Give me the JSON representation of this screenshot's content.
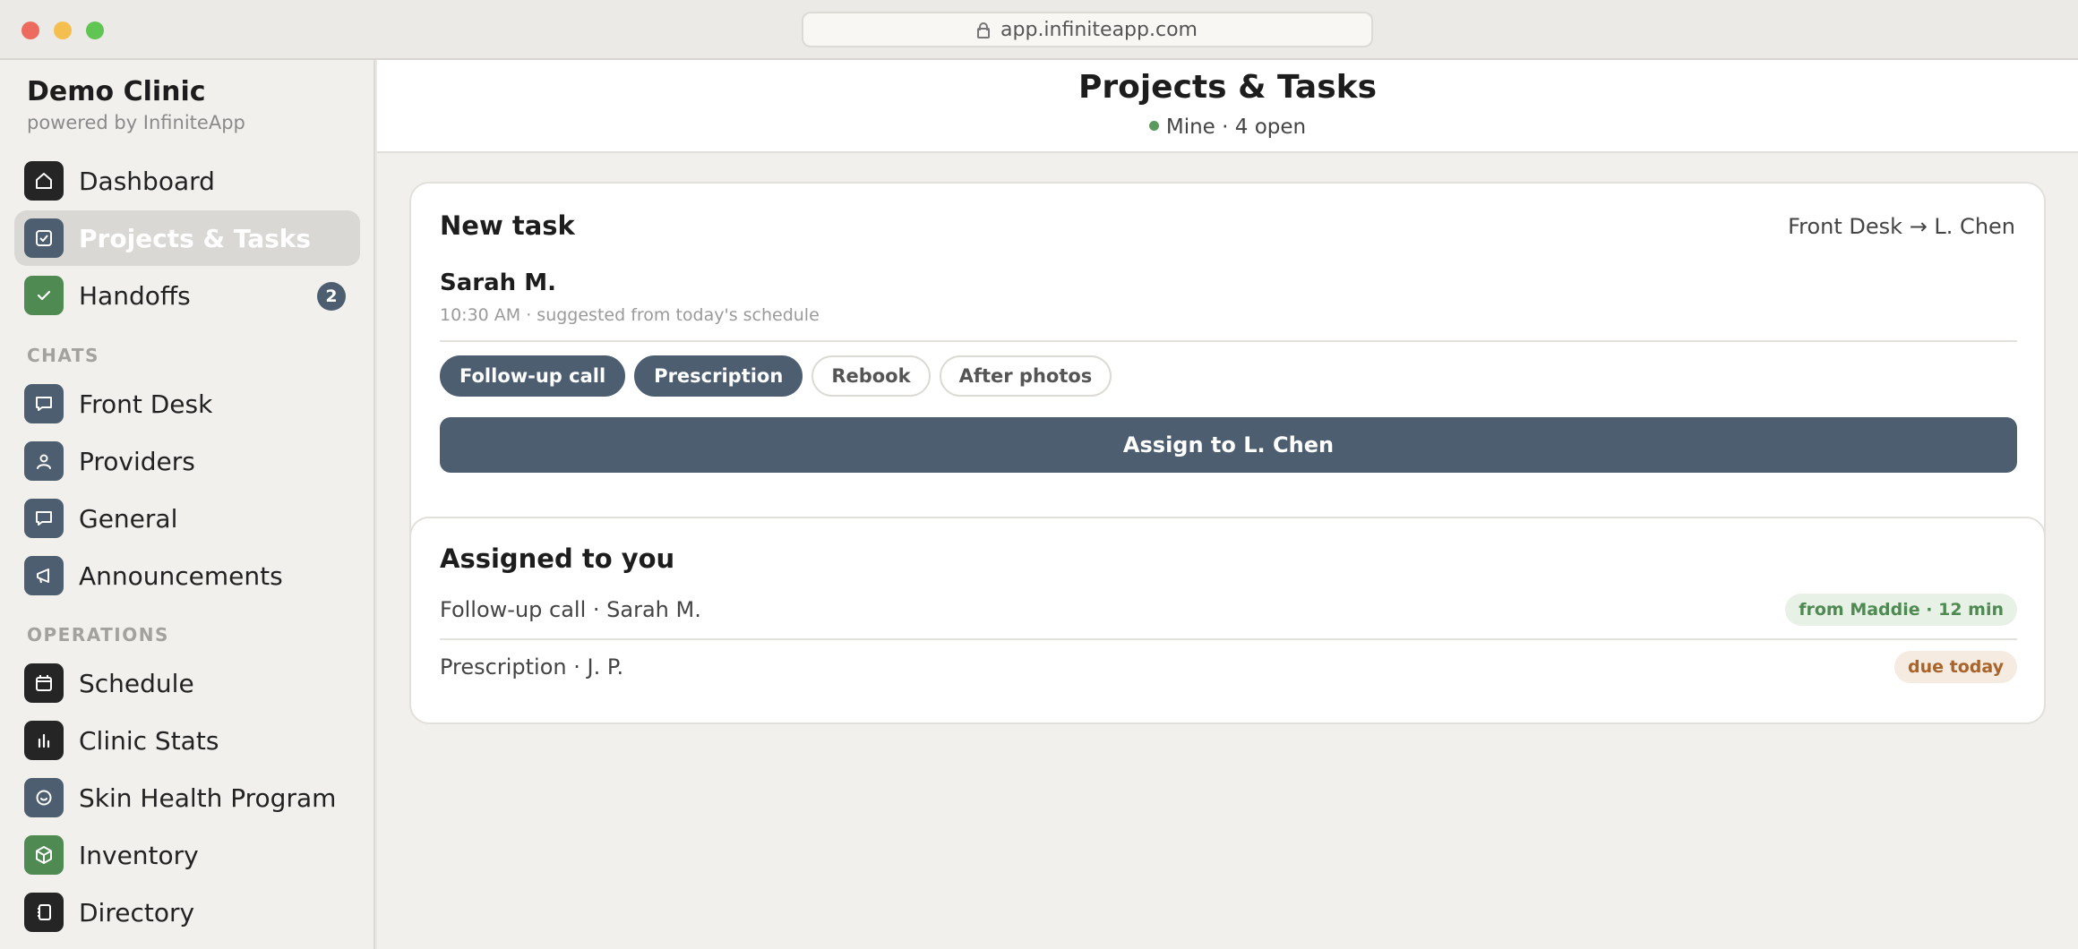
{
  "browser": {
    "url": "app.infiniteapp.com"
  },
  "sidebar": {
    "brand_title": "Demo Clinic",
    "brand_subtitle": "powered by InfiniteApp",
    "top_items": [
      {
        "label": "Dashboard",
        "icon": "home-icon"
      },
      {
        "label": "Projects & Tasks",
        "icon": "checkbox-icon",
        "active": true
      },
      {
        "label": "Handoffs",
        "icon": "check-icon",
        "badge": "2"
      }
    ],
    "chats_label": "CHATS",
    "chat_items": [
      {
        "label": "Front Desk",
        "icon": "chat-bubble-icon"
      },
      {
        "label": "Providers",
        "icon": "person-icon"
      },
      {
        "label": "General",
        "icon": "chat-bubble-icon"
      },
      {
        "label": "Announcements",
        "icon": "megaphone-icon"
      }
    ],
    "operations_label": "OPERATIONS",
    "operation_items": [
      {
        "label": "Schedule",
        "icon": "calendar-icon"
      },
      {
        "label": "Clinic Stats",
        "icon": "bar-chart-icon"
      },
      {
        "label": "Skin Health Program",
        "icon": "smile-icon"
      },
      {
        "label": "Inventory",
        "icon": "box-icon"
      },
      {
        "label": "Directory",
        "icon": "book-icon"
      }
    ]
  },
  "header": {
    "title": "Projects & Tasks",
    "subtitle": "Mine · 4 open",
    "status_color": "#5a9a5e"
  },
  "new_task": {
    "title": "New task",
    "route": "Front Desk → L. Chen",
    "patient_name": "Sarah M.",
    "patient_meta": "10:30 AM · suggested from today's schedule",
    "chips": [
      {
        "label": "Follow-up call",
        "selected": true
      },
      {
        "label": "Prescription",
        "selected": true
      },
      {
        "label": "Rebook",
        "selected": false
      },
      {
        "label": "After photos",
        "selected": false
      }
    ],
    "assign_label": "Assign to L. Chen"
  },
  "assigned": {
    "title": "Assigned to you",
    "rows": [
      {
        "label": "Follow-up call · Sarah M.",
        "tag": "from Maddie · 12 min",
        "tag_color": "#4f8a53"
      },
      {
        "label": "Prescription · J. P.",
        "tag": "due today",
        "tag_color": "#a8642a"
      }
    ]
  },
  "colors": {
    "accent": "#4c5e70",
    "success": "#4f8a53",
    "warning": "#a8642a"
  }
}
